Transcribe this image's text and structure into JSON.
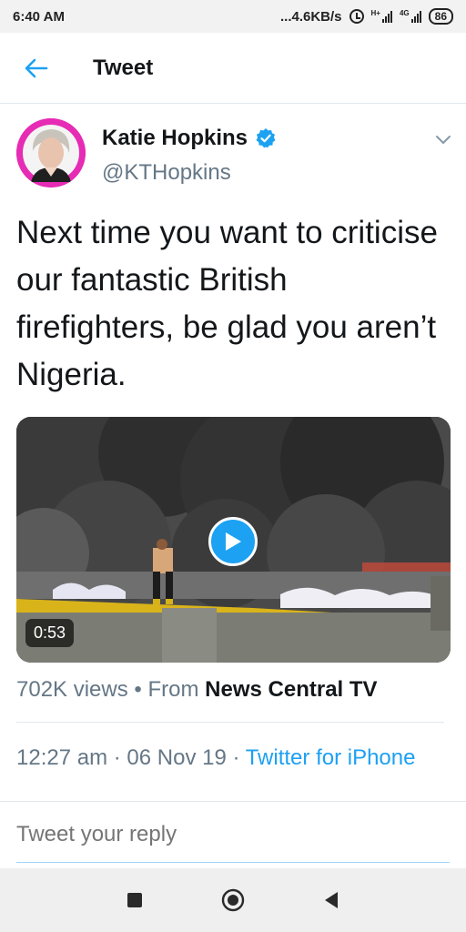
{
  "status_bar": {
    "time": "6:40 AM",
    "network_speed": "...4.6KB/s",
    "net_label_1": "H+",
    "net_label_2": "4G",
    "battery": "86"
  },
  "header": {
    "title": "Tweet",
    "back_icon": "arrow-left-icon"
  },
  "tweet": {
    "author_name": "Katie Hopkins",
    "handle": "@KTHopkins",
    "verified": true,
    "text": "Next time you want to criticise our fantastic British firefighters, be glad you aren’t Nigeria.",
    "video": {
      "duration": "0:53",
      "play_icon": "play-icon"
    },
    "views": "702K views",
    "separator": " • ",
    "from_label": "From ",
    "source": "News Central TV",
    "time": "12:27 am",
    "dot": " · ",
    "date": "06 Nov 19",
    "client": "Twitter for iPhone"
  },
  "reply": {
    "placeholder": "Tweet your reply"
  },
  "colors": {
    "accent": "#1da1f2",
    "secondary_text": "#657786",
    "avatar_bg": "#e62bb5"
  }
}
